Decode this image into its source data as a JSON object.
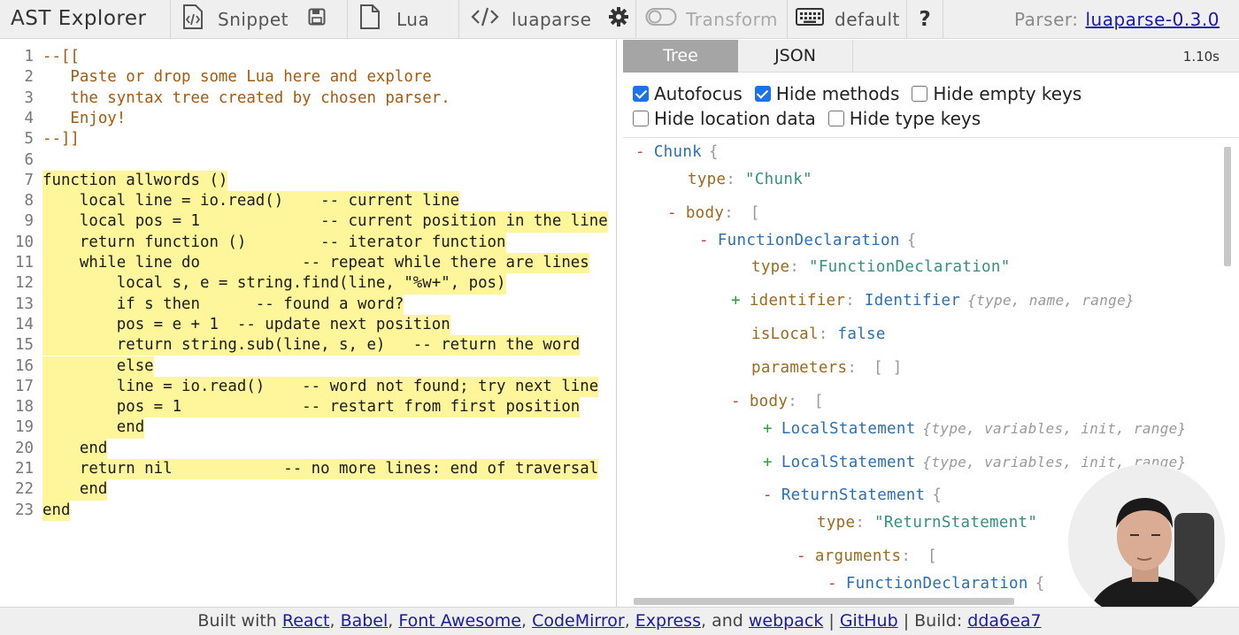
{
  "toolbar": {
    "title": "AST Explorer",
    "snippet_label": "Snippet",
    "language_label": "Lua",
    "parser_label": "luaparse",
    "transform_label": "Transform",
    "keymap_label": "default",
    "help_label": "?",
    "parser_info_label": "Parser:",
    "parser_version": "luaparse-0.3.0",
    "icons": [
      "code-file-icon",
      "save-icon",
      "file-icon",
      "code-icon",
      "gear-icon",
      "toggle-icon",
      "keyboard-icon"
    ]
  },
  "editor": {
    "lines": [
      {
        "n": "1",
        "text": "--[[",
        "comment": true,
        "hl": false
      },
      {
        "n": "2",
        "text": "   Paste or drop some Lua here and explore",
        "comment": true,
        "hl": false
      },
      {
        "n": "3",
        "text": "   the syntax tree created by chosen parser.",
        "comment": true,
        "hl": false
      },
      {
        "n": "4",
        "text": "   Enjoy!",
        "comment": true,
        "hl": false
      },
      {
        "n": "5",
        "text": "--]]",
        "comment": true,
        "hl": false
      },
      {
        "n": "6",
        "text": "",
        "comment": false,
        "hl": false
      },
      {
        "n": "7",
        "text": "function allwords ()",
        "comment": false,
        "hl": true
      },
      {
        "n": "8",
        "text": "    local line = io.read()    -- current line",
        "comment": false,
        "hl": true
      },
      {
        "n": "9",
        "text": "    local pos = 1             -- current position in the line",
        "comment": false,
        "hl": true
      },
      {
        "n": "10",
        "text": "    return function ()        -- iterator function",
        "comment": false,
        "hl": true
      },
      {
        "n": "11",
        "text": "    while line do           -- repeat while there are lines",
        "comment": false,
        "hl": true
      },
      {
        "n": "12",
        "text": "        local s, e = string.find(line, \"%w+\", pos)",
        "comment": false,
        "hl": true
      },
      {
        "n": "13",
        "text": "        if s then      -- found a word?",
        "comment": false,
        "hl": true
      },
      {
        "n": "14",
        "text": "        pos = e + 1  -- update next position",
        "comment": false,
        "hl": true
      },
      {
        "n": "15",
        "text": "        return string.sub(line, s, e)   -- return the word",
        "comment": false,
        "hl": true
      },
      {
        "n": "16",
        "text": "        else",
        "comment": false,
        "hl": true
      },
      {
        "n": "17",
        "text": "        line = io.read()    -- word not found; try next line",
        "comment": false,
        "hl": true
      },
      {
        "n": "18",
        "text": "        pos = 1             -- restart from first position",
        "comment": false,
        "hl": true
      },
      {
        "n": "19",
        "text": "        end",
        "comment": false,
        "hl": true
      },
      {
        "n": "20",
        "text": "    end",
        "comment": false,
        "hl": true
      },
      {
        "n": "21",
        "text": "    return nil            -- no more lines: end of traversal",
        "comment": false,
        "hl": true
      },
      {
        "n": "22",
        "text": "    end",
        "comment": false,
        "hl": true
      },
      {
        "n": "23",
        "text": "end",
        "comment": false,
        "hl": true
      }
    ]
  },
  "output": {
    "tabs": [
      "Tree",
      "JSON"
    ],
    "active_tab": "Tree",
    "time": "1.10s",
    "options": [
      {
        "label": "Autofocus",
        "checked": true
      },
      {
        "label": "Hide methods",
        "checked": true
      },
      {
        "label": "Hide empty keys",
        "checked": false
      },
      {
        "label": "Hide location data",
        "checked": false
      },
      {
        "label": "Hide type keys",
        "checked": false
      }
    ],
    "tree": [
      {
        "toggle": "-",
        "key": "",
        "type": "Chunk",
        "brace": "{"
      },
      {
        "toggle": "",
        "key": "type",
        "string": "\"Chunk\""
      },
      {
        "toggle": "-",
        "key": "body",
        "brace": "["
      },
      {
        "toggle": "-",
        "key": "",
        "type": "FunctionDeclaration",
        "brace": "{"
      },
      {
        "toggle": "",
        "key": "type",
        "string": "\"FunctionDeclaration\""
      },
      {
        "toggle": "+",
        "key": "identifier",
        "type": "Identifier",
        "summary": "{type, name, range}"
      },
      {
        "toggle": "",
        "key": "isLocal",
        "bool": "false"
      },
      {
        "toggle": "",
        "key": "parameters",
        "brace": "[ ]"
      },
      {
        "toggle": "-",
        "key": "body",
        "brace": "["
      },
      {
        "toggle": "+",
        "key": "",
        "type": "LocalStatement",
        "summary": "{type, variables, init, range}"
      },
      {
        "toggle": "+",
        "key": "",
        "type": "LocalStatement",
        "summary": "{type, variables, init, range}"
      },
      {
        "toggle": "-",
        "key": "",
        "type": "ReturnStatement",
        "brace": "{"
      },
      {
        "toggle": "",
        "key": "type",
        "string": "\"ReturnStatement\""
      },
      {
        "toggle": "-",
        "key": "arguments",
        "brace": "["
      },
      {
        "toggle": "-",
        "key": "",
        "type": "FunctionDeclaration",
        "brace": "{"
      }
    ]
  },
  "footer": {
    "prefix": "Built with",
    "links": [
      "React",
      "Babel",
      "Font Awesome",
      "CodeMirror",
      "Express",
      "webpack"
    ],
    "and_label": "and",
    "github_label": "GitHub",
    "build_label": "Build:",
    "build_hash": "dda6ea7"
  },
  "colors": {
    "highlight": "#fff59a",
    "comment": "#a55a0e",
    "link": "#1a1aa6",
    "tab_active": "#a5a5a5",
    "checkbox_on": "#1a73e8",
    "tree_type": "#2b6fb4",
    "tree_key": "#9a6a1e",
    "tree_string": "#32927f"
  }
}
